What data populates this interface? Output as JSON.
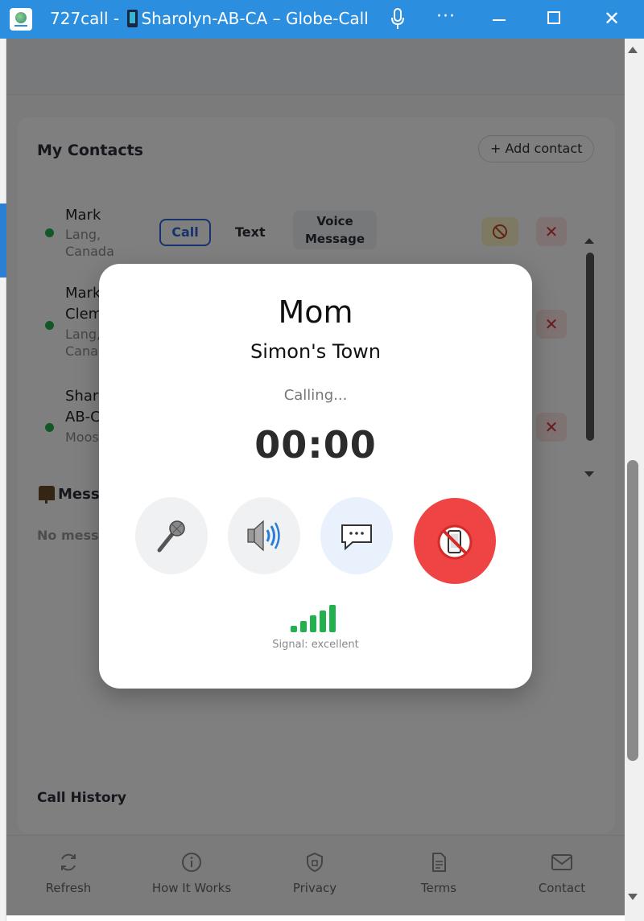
{
  "window": {
    "title_prefix": "727call - ",
    "title_suffix": "Sharolyn-AB-CA – Globe-Call",
    "more": "···",
    "close": "✕"
  },
  "contacts": {
    "title": "My Contacts",
    "add_label": "+ Add contact",
    "items": [
      {
        "name": "Mark",
        "sub1": "Lang,",
        "sub2": "Canada",
        "call": "Call",
        "text": "Text",
        "voice1": "Voice",
        "voice2": "Message",
        "delete": "✕"
      },
      {
        "name1": "Mark",
        "name2": "Clem",
        "sub1": "Lang,",
        "sub2": "Cana",
        "delete": "✕"
      },
      {
        "name1": "Shar",
        "name2": "AB-C",
        "sub1": "Moos",
        "delete": "✕"
      }
    ]
  },
  "messages": {
    "title": "Messa",
    "empty": "No mess"
  },
  "call_history": {
    "title": "Call History"
  },
  "nav": {
    "refresh": "Refresh",
    "how": "How It Works",
    "privacy": "Privacy",
    "terms": "Terms",
    "contact": "Contact"
  },
  "call_modal": {
    "name": "Mom",
    "location": "Simon's Town",
    "status": "Calling...",
    "timer": "00:00",
    "signal_label": "Signal: excellent",
    "signal_level": 5,
    "signal_max": 5
  },
  "colors": {
    "titlebar": "#2b8ede",
    "hangup": "#ee4444",
    "signal": "#22b14c",
    "call_accent": "#2e66d6"
  }
}
